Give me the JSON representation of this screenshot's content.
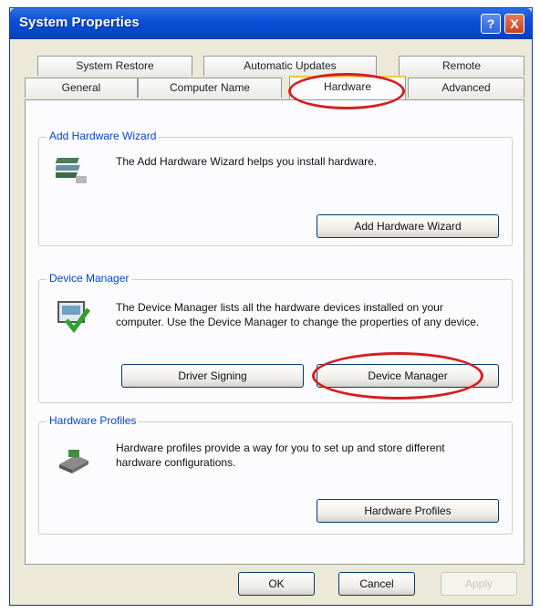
{
  "window": {
    "title": "System Properties",
    "help_label": "?",
    "close_label": "X"
  },
  "tabs": {
    "row1": [
      "System Restore",
      "Automatic Updates",
      "Remote"
    ],
    "row2": [
      "General",
      "Computer Name",
      "Hardware",
      "Advanced"
    ],
    "active": "Hardware"
  },
  "groups": {
    "add_hardware": {
      "label": "Add Hardware Wizard",
      "text": "The Add Hardware Wizard helps you install hardware.",
      "button": "Add Hardware Wizard"
    },
    "device_manager": {
      "label": "Device Manager",
      "text": "The Device Manager lists all the hardware devices installed on your computer. Use the Device Manager to change the properties of any device.",
      "driver_button": "Driver Signing",
      "dm_button": "Device Manager"
    },
    "hardware_profiles": {
      "label": "Hardware Profiles",
      "text": "Hardware profiles provide a way for you to set up and store different hardware configurations.",
      "button": "Hardware Profiles"
    }
  },
  "footer": {
    "ok": "OK",
    "cancel": "Cancel",
    "apply": "Apply"
  },
  "colors": {
    "highlight_oval": "#d41f1f",
    "group_label": "#0046d5"
  }
}
